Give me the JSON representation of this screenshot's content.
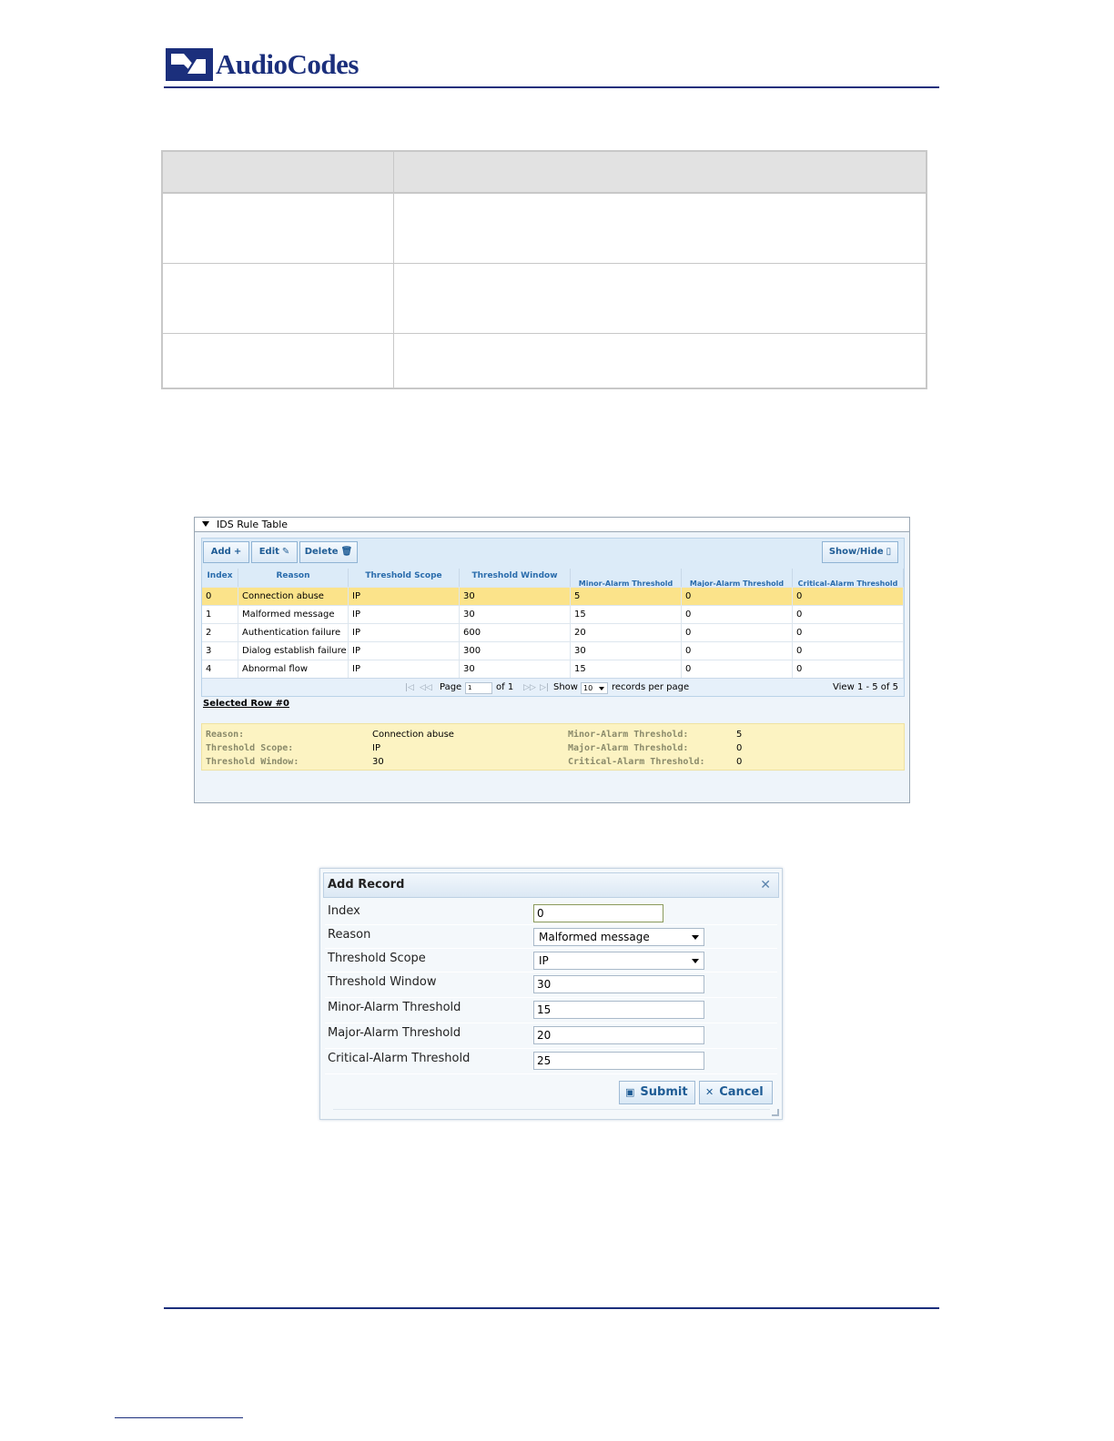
{
  "header": {
    "logo_text": "AudioCodes",
    "brand_color": "#1b2f7c"
  },
  "ids_table": {
    "title": "IDS Rule Table",
    "toolbar": {
      "add_label": "Add",
      "add_icon": "plus-icon",
      "edit_label": "Edit",
      "edit_icon": "pencil-icon",
      "delete_label": "Delete",
      "delete_icon": "trash-icon",
      "show_hide_label": "Show/Hide",
      "show_hide_icon": "document-icon"
    },
    "columns": [
      "Index",
      "Reason",
      "Threshold Scope",
      "Threshold Window",
      "Minor-Alarm Threshold",
      "Major-Alarm Threshold",
      "Critical-Alarm Threshold"
    ],
    "rows": [
      [
        "0",
        "Connection abuse",
        "IP",
        "30",
        "5",
        "0",
        "0"
      ],
      [
        "1",
        "Malformed message",
        "IP",
        "30",
        "15",
        "0",
        "0"
      ],
      [
        "2",
        "Authentication failure",
        "IP",
        "600",
        "20",
        "0",
        "0"
      ],
      [
        "3",
        "Dialog establish failure",
        "IP",
        "300",
        "30",
        "0",
        "0"
      ],
      [
        "4",
        "Abnormal flow",
        "IP",
        "30",
        "15",
        "0",
        "0"
      ]
    ],
    "selected_row_index": 0,
    "selected_color": "#fbe38a",
    "pager": {
      "page_label": "Page",
      "page_value": "1",
      "of_label": "of 1",
      "show_label": "Show",
      "per_page_value": "10",
      "records_label": "records per page",
      "view_label": "View 1 - 5 of 5"
    },
    "selected_row_label": "Selected Row #0",
    "detail": {
      "reason_label": "Reason:",
      "reason_value": "Connection abuse",
      "scope_label": "Threshold Scope:",
      "scope_value": "IP",
      "window_label": "Threshold Window:",
      "window_value": "30",
      "minor_label": "Minor-Alarm Threshold:",
      "minor_value": "5",
      "major_label": "Major-Alarm Threshold:",
      "major_value": "0",
      "critical_label": "Critical-Alarm Threshold:",
      "critical_value": "0"
    }
  },
  "dialog": {
    "title": "Add Record",
    "close_icon": "close-icon",
    "fields": {
      "index_label": "Index",
      "index_value": "0",
      "reason_label": "Reason",
      "reason_value": "Malformed message",
      "scope_label": "Threshold Scope",
      "scope_value": "IP",
      "window_label": "Threshold Window",
      "window_value": "30",
      "minor_label": "Minor-Alarm Threshold",
      "minor_value": "15",
      "major_label": "Major-Alarm Threshold",
      "major_value": "20",
      "critical_label": "Critical-Alarm Threshold",
      "critical_value": "25"
    },
    "submit_label": "Submit",
    "submit_icon": "save-icon",
    "cancel_label": "Cancel",
    "cancel_icon": "close-icon"
  }
}
